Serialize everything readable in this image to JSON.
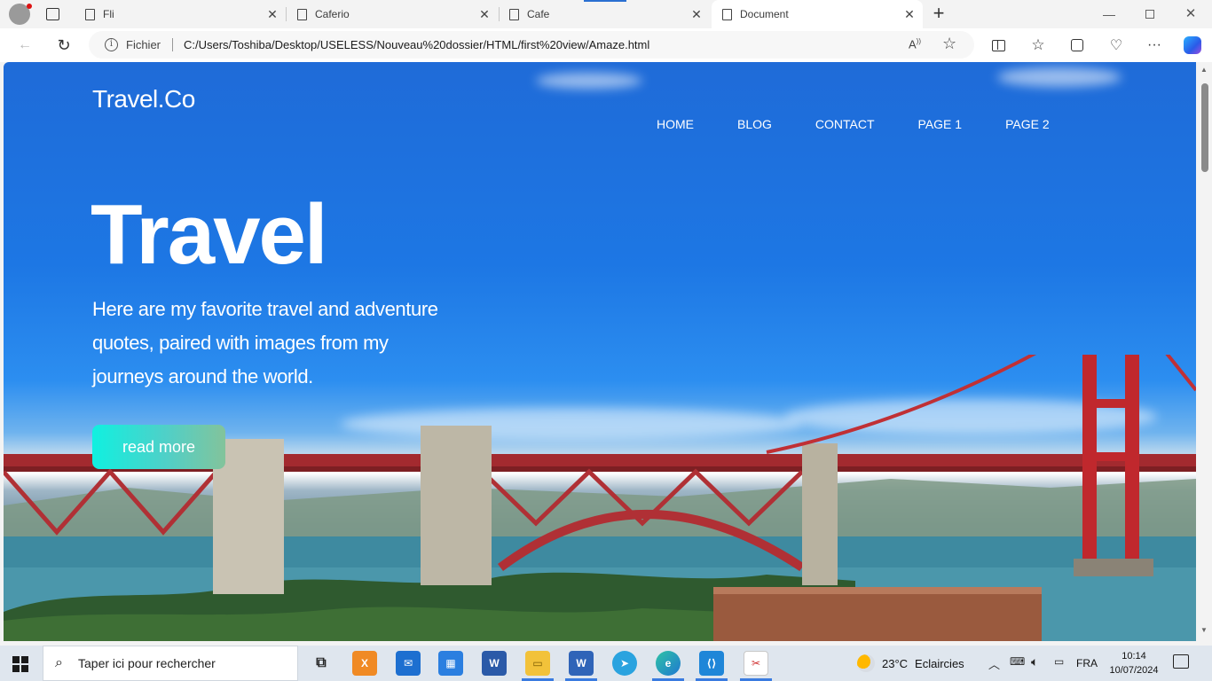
{
  "browser": {
    "tabs": [
      {
        "label": "Fli"
      },
      {
        "label": "Caferio"
      },
      {
        "label": "Cafe"
      },
      {
        "label": "Document"
      }
    ],
    "address": {
      "protocol_label": "Fichier",
      "url": "C:/Users/Toshiba/Desktop/USELESS/Nouveau%20dossier/HTML/first%20view/Amaze.html"
    }
  },
  "page": {
    "brand": "Travel.Co",
    "nav": [
      "HOME",
      "BLOG",
      "CONTACT",
      "PAGE 1",
      "PAGE 2"
    ],
    "hero_title": "Travel",
    "hero_text": "Here are my favorite travel and adventure quotes, paired with images from my journeys around the world.",
    "cta_label": "read more"
  },
  "taskbar": {
    "search_placeholder": "Taper ici pour rechercher",
    "weather_temp": "23°C",
    "weather_text": "Eclaircies",
    "language": "FRA",
    "time": "10:14",
    "date": "10/07/2024"
  },
  "colors": {
    "sky_top": "#1f6bd8",
    "bridge_red": "#c0282d",
    "cta_start": "#10f0e0",
    "cta_end": "#83c39b",
    "taskbar": "#dfe6ee"
  }
}
